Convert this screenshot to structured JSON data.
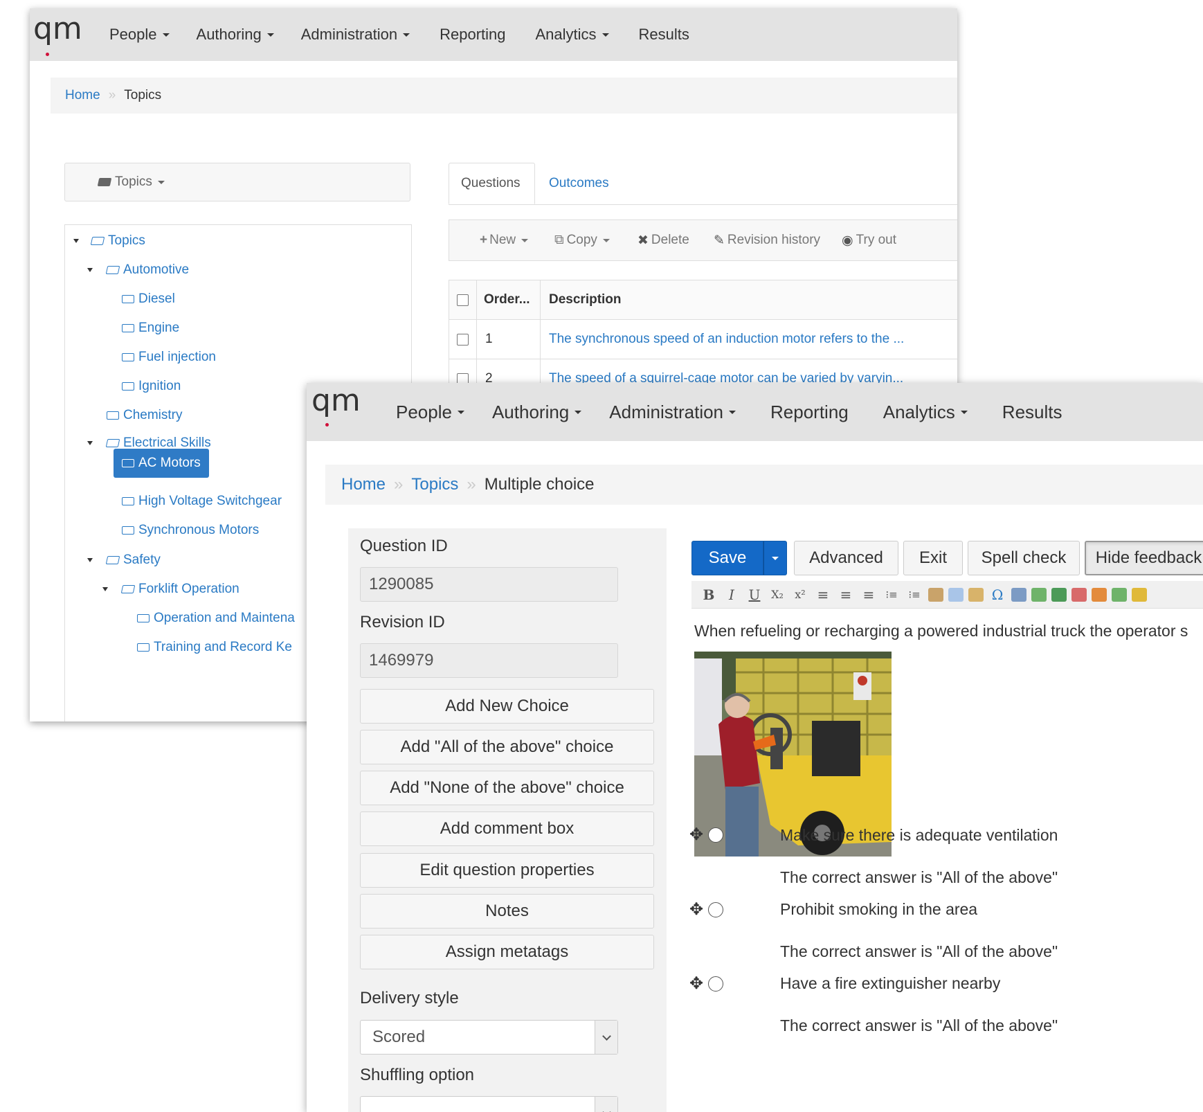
{
  "back_window": {
    "nav": {
      "logo": "qm",
      "items": [
        {
          "label": "People",
          "dropdown": true
        },
        {
          "label": "Authoring",
          "dropdown": true
        },
        {
          "label": "Administration",
          "dropdown": true
        },
        {
          "label": "Reporting",
          "dropdown": false
        },
        {
          "label": "Analytics",
          "dropdown": true
        },
        {
          "label": "Results",
          "dropdown": false
        }
      ]
    },
    "breadcrumb": {
      "home": "Home",
      "current": "Topics"
    },
    "topics_dropdown": "Topics",
    "tree": [
      {
        "label": "Topics",
        "level": 0,
        "expanded": true
      },
      {
        "label": "Automotive",
        "level": 1,
        "expanded": true
      },
      {
        "label": "Diesel",
        "level": 2
      },
      {
        "label": "Engine",
        "level": 2
      },
      {
        "label": "Fuel injection",
        "level": 2
      },
      {
        "label": "Ignition",
        "level": 2
      },
      {
        "label": "Chemistry",
        "level": 1
      },
      {
        "label": "Electrical Skills",
        "level": 1,
        "expanded": true
      },
      {
        "label": "AC Motors",
        "level": 2,
        "selected": true
      },
      {
        "label": "High Voltage Switchgear",
        "level": 2
      },
      {
        "label": "Synchronous Motors",
        "level": 2
      },
      {
        "label": "Safety",
        "level": 1,
        "expanded": true
      },
      {
        "label": "Forklift Operation",
        "level": 2,
        "expanded": true
      },
      {
        "label": "Operation and Maintena",
        "level": 3
      },
      {
        "label": "Training and Record Ke",
        "level": 3
      }
    ],
    "tabs": {
      "questions": "Questions",
      "outcomes": "Outcomes"
    },
    "toolbar": {
      "new": "New",
      "copy": "Copy",
      "delete": "Delete",
      "revision": "Revision history",
      "tryout": "Try out"
    },
    "grid": {
      "headers": {
        "order": "Order...",
        "description": "Description"
      },
      "rows": [
        {
          "order": "1",
          "description": "The synchronous speed of an induction motor refers to the ..."
        },
        {
          "order": "2",
          "description": "The speed of a squirrel-cage motor can be varied by varyin..."
        }
      ]
    }
  },
  "front_window": {
    "nav": {
      "logo": "qm",
      "items": [
        {
          "label": "People",
          "dropdown": true
        },
        {
          "label": "Authoring",
          "dropdown": true
        },
        {
          "label": "Administration",
          "dropdown": true
        },
        {
          "label": "Reporting",
          "dropdown": false
        },
        {
          "label": "Analytics",
          "dropdown": true
        },
        {
          "label": "Results",
          "dropdown": false
        }
      ]
    },
    "breadcrumb": {
      "home": "Home",
      "topics": "Topics",
      "current": "Multiple choice"
    },
    "side": {
      "question_id_label": "Question ID",
      "question_id": "1290085",
      "revision_id_label": "Revision ID",
      "revision_id": "1469979",
      "buttons": [
        "Add New Choice",
        "Add \"All of the above\" choice",
        "Add \"None of the above\" choice",
        "Add comment box",
        "Edit question properties",
        "Notes",
        "Assign metatags"
      ],
      "delivery_style_label": "Delivery style",
      "delivery_style": "Scored",
      "shuffling_label": "Shuffling option"
    },
    "actions": {
      "save": "Save",
      "advanced": "Advanced",
      "exit": "Exit",
      "spell": "Spell check",
      "hide_feedback": "Hide feedback"
    },
    "editor_tools": [
      "B",
      "I",
      "U",
      "X₂",
      "x²",
      "≡",
      "≡",
      "≡",
      "⁝≡",
      "⁝≡"
    ],
    "question_text": "When refueling or recharging a powered industrial truck the operator s",
    "choices": [
      {
        "text": "Make sure there is adequate ventilation",
        "feedback": "The correct answer is \"All of the above\""
      },
      {
        "text": "Prohibit smoking in the area",
        "feedback": "The correct answer is \"All of the above\""
      },
      {
        "text": "Have a fire extinguisher nearby",
        "feedback": "The correct answer is \"All of the above\""
      }
    ],
    "colors": {
      "accent": "#1469c7",
      "link": "#2a7ac4",
      "logo_dot": "#d0103a",
      "navbar": "#e3e3e3"
    }
  }
}
